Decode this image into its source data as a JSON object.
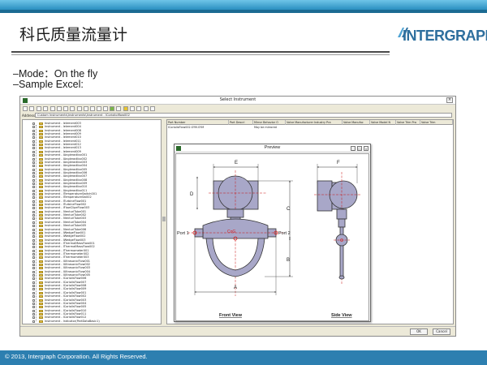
{
  "slide": {
    "title": "科氏质量流量计",
    "logo": "INTERGRAPH",
    "bullets": [
      "–Mode：On the fly",
      "–Sample Excel:"
    ],
    "footer": "© 2013, Intergraph Corporation. All Rights Reserved."
  },
  "window": {
    "title": "Select Instrument",
    "address_label": "Address",
    "address_value": "Custom Instruments\\Instruments\\Instrument - ICorioliolflow002"
  },
  "tree": {
    "items": [
      "Instrument - Ielement003",
      "Instrument - Ielement004",
      "Instrument - Ielement008",
      "Instrument - Ielement009",
      "Instrument - Ielement010",
      "Instrument - Ielement011",
      "Instrument - Ielement012",
      "Instrument - Ielement013",
      "Instrument - Ielement009",
      "Instrument - IAngleradilco001",
      "Instrument - IAngleradilco002",
      "Instrument - IAngleradilco003",
      "Instrument - IAngleradilco004",
      "Instrument - IAngleradilco005",
      "Instrument - IAngleradilco006",
      "Instrument - IAngleradilco007",
      "Instrument - IAngleradilco008",
      "Instrument - IAngleradilco009",
      "Instrument - IAngleradilco010",
      "Instrument - IAngleradilco011",
      "Instrument - ITemperatureSwitch001",
      "Instrument - ITemperatureSw002",
      "Instrument - ITurbineFlow001",
      "Instrument - ITurbineFlow002",
      "Instrument - IFlowClipeFlow003",
      "Instrument - IVenturiTube001",
      "Instrument - IVenturiTube002",
      "Instrument - IVenturiTube003",
      "Instrument - IVenturiTube004",
      "Instrument - IVenturiTube005",
      "Instrument - IVenturiTube006",
      "Instrument - IWedgeFlow001",
      "Instrument - IWedgeFlow002",
      "Instrument - IWedgeFlow003",
      "Instrument - IThermalMassFlow001",
      "Instrument - IThermalMassFlow002",
      "Instrument - IThermometer001",
      "Instrument - IThermometer002",
      "Instrument - IThermometer003",
      "Instrument - IUltrasonicFlow001",
      "Instrument - IUltrasonicFlow002",
      "Instrument - IUltrasonicFlow003",
      "Instrument - IUltrasonicFlow004",
      "Instrument - IUltrasonicFlow005",
      "Instrument - ICoriolisFlow006",
      "Instrument - ICoriolisFlow007",
      "Instrument - ICoriolisFlow008",
      "Instrument - ICoriolisFlow009",
      "Instrument - ICoriolisFlow001",
      "Instrument - ICoriolisFlow002",
      "Instrument - ICoriolisFlow003",
      "Instrument - ICoriolisFlow004",
      "Instrument - ICoriolisFlow005",
      "Instrument - ICoriolisFlow010",
      "Instrument - ICoriolisFlow011",
      "Instrument - ICoriolisFlow012",
      "Instrument - Indicator(PartDataBasic1)"
    ]
  },
  "grid": {
    "columns": [
      "Part Number",
      "Part Descri",
      "Mirror Behavior O",
      "Valve Manufacturer Industry Pra",
      "Valve Manufac",
      "Valve Model N",
      "Valve Trim Pra",
      "Valve Trim"
    ],
    "row": [
      "ICoriolisFlow002.SYM.SYM",
      "",
      "May be mirrored",
      "",
      "",
      "",
      "",
      ""
    ]
  },
  "preview": {
    "title": "Preview",
    "front_view_label": "Front View",
    "side_view_label": "Side View",
    "port1_label": "Port 1",
    "port2_label": "Port 2",
    "cog_label": "CoG",
    "dim_labels": {
      "a": "A",
      "b": "B",
      "c": "C",
      "d": "D",
      "e": "E",
      "f": "F"
    }
  },
  "statusbar": {
    "ok": "OK",
    "cancel": "Cancel"
  },
  "colors": {
    "band_light": "#6fc5e8",
    "band_dark": "#1c6b93",
    "footer": "#2d7fb0",
    "body_fill": "#a8a7c8",
    "dim_red": "#c81414",
    "cog_red": "#d81a1a"
  }
}
